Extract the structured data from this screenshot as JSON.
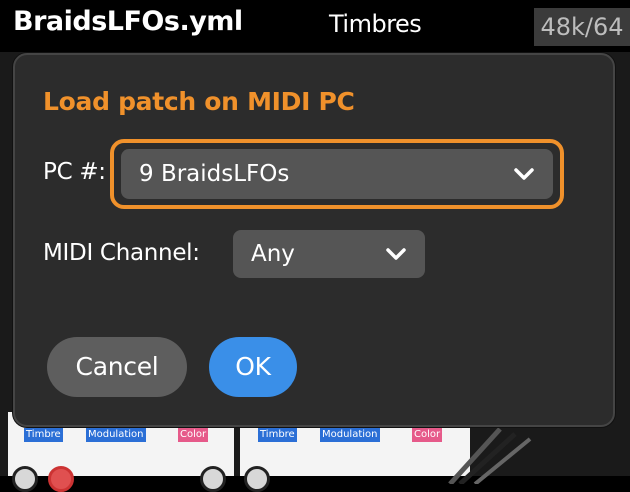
{
  "header": {
    "patch_name": "BraidsLFOs.yml",
    "page_name": "Timbres",
    "sample_rate": "48k/64"
  },
  "background": {
    "left_module": {
      "tags": [
        "Timbre",
        "Modulation",
        "Color"
      ]
    },
    "right_module": {
      "tags": [
        "Timbre",
        "Modulation",
        "Color"
      ]
    }
  },
  "dialog": {
    "title": "Load patch on MIDI PC",
    "pc_label": "PC #:",
    "pc_value": "9 BraidsLFOs",
    "channel_label": "MIDI Channel:",
    "channel_value": "Any",
    "cancel_label": "Cancel",
    "ok_label": "OK"
  },
  "colors": {
    "accent": "#f0912b",
    "ok_button": "#3a8fe8",
    "dialog_bg": "#2c2c2c"
  }
}
